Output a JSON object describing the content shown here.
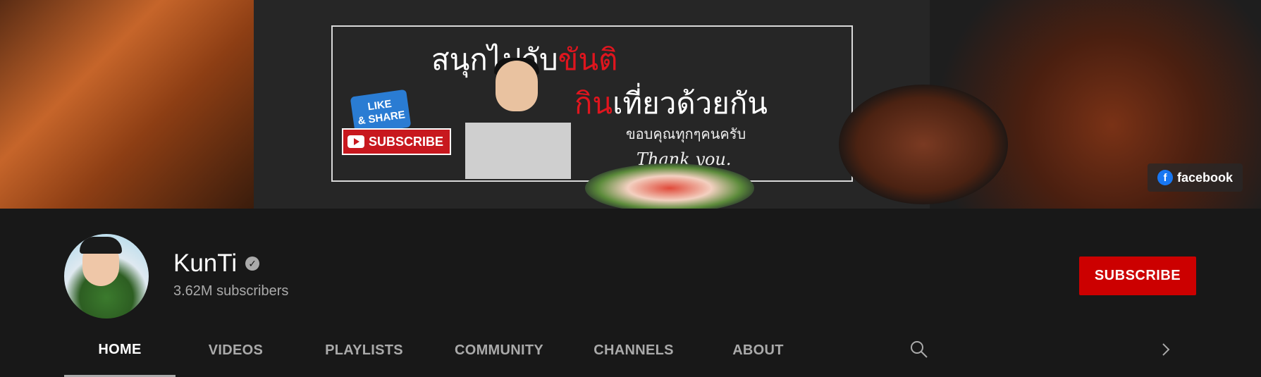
{
  "banner": {
    "headline_part1": "สนุกไปกับ",
    "headline_part1_red": "ขันติ",
    "headline_part2_red": "กิน",
    "headline_part2": "เที่ยวด้วยกัน",
    "thanks_thai": "ขอบคุณทุกๆคนครับ",
    "thanks_en": "Thank you.",
    "like_line1": "LIKE",
    "like_line2": "& SHARE",
    "subscribe_badge": "SUBSCRIBE",
    "facebook_label": "facebook"
  },
  "channel": {
    "name": "KunTi",
    "subscribers": "3.62M subscribers",
    "subscribe_button": "SUBSCRIBE"
  },
  "tabs": [
    {
      "label": "HOME",
      "active": true
    },
    {
      "label": "VIDEOS",
      "active": false
    },
    {
      "label": "PLAYLISTS",
      "active": false
    },
    {
      "label": "COMMUNITY",
      "active": false
    },
    {
      "label": "CHANNELS",
      "active": false
    },
    {
      "label": "ABOUT",
      "active": false
    }
  ],
  "icons": {
    "search": "search-icon",
    "next": "chevron-right-icon",
    "verified": "verified-check-icon",
    "facebook": "facebook-icon"
  },
  "colors": {
    "background": "#181818",
    "subscribe": "#cc0000",
    "accent_red": "#e0151e",
    "muted_text": "#aaaaaa"
  }
}
